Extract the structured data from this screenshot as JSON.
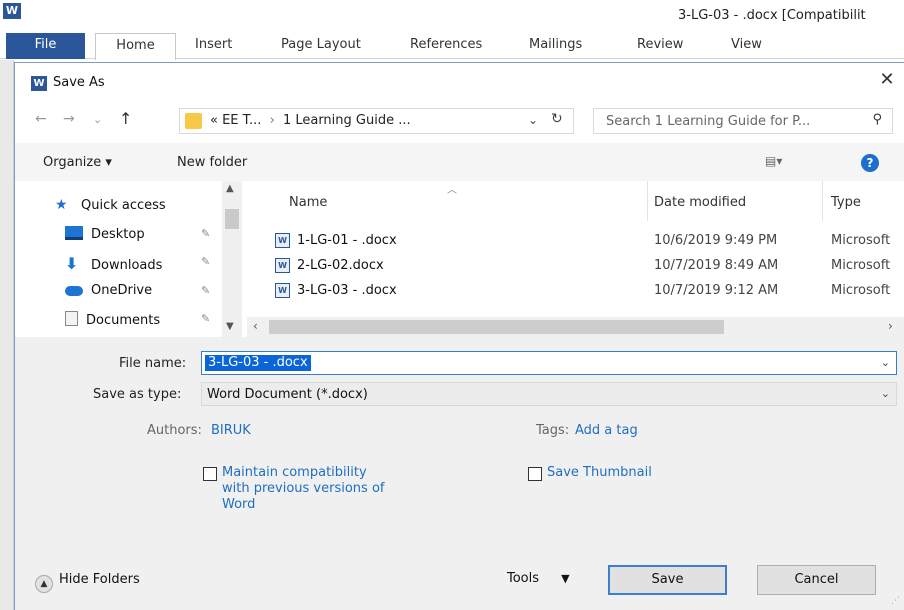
{
  "word": {
    "logo": "W",
    "title": "3-LG-03 - .docx [Compatibilit",
    "tabs": {
      "file": "File",
      "home": "Home",
      "insert": "Insert",
      "page_layout": "Page Layout",
      "references": "References",
      "mailings": "Mailings",
      "review": "Review",
      "view": "View"
    }
  },
  "dialog": {
    "icon": "W",
    "title": "Save As",
    "close": "✕",
    "address": {
      "crumb1": "«  EE T...",
      "sep": "›",
      "crumb2": "1 Learning Guide ...",
      "dropdown": "⌄",
      "refresh": "↻"
    },
    "search": {
      "placeholder": "Search 1 Learning Guide for P...",
      "icon": "magnifier-icon"
    },
    "toolbar": {
      "organize": "Organize ▾",
      "new_folder": "New folder",
      "view": "▤▾",
      "help": "?"
    },
    "nav_pane": {
      "items": [
        {
          "label": "Quick access",
          "icon": "star-icon"
        },
        {
          "label": "Desktop",
          "icon": "desktop-icon"
        },
        {
          "label": "Downloads",
          "icon": "download-icon"
        },
        {
          "label": "OneDrive",
          "icon": "cloud-icon"
        },
        {
          "label": "Documents",
          "icon": "document-icon"
        }
      ],
      "pin": "📌"
    },
    "columns": {
      "name": "Name",
      "date": "Date modified",
      "type": "Type"
    },
    "files": [
      {
        "name": "1-LG-01 - .docx",
        "date": "10/6/2019 9:49 PM",
        "type": "Microsoft"
      },
      {
        "name": "2-LG-02.docx",
        "date": "10/7/2019 8:49 AM",
        "type": "Microsoft"
      },
      {
        "name": "3-LG-03 - .docx",
        "date": "10/7/2019 9:12 AM",
        "type": "Microsoft"
      }
    ],
    "file_name_label": "File name:",
    "file_name_value": "3-LG-03 - .docx",
    "save_type_label": "Save as type:",
    "save_type_value": "Word Document (*.docx)",
    "authors_label": "Authors:",
    "authors_value": "BIRUK",
    "tags_label": "Tags:",
    "tags_value": "Add a tag",
    "maintain_compat": "Maintain compatibility with previous versions of Word",
    "save_thumbnail": "Save Thumbnail",
    "hide_folders": "Hide Folders",
    "tools": "Tools",
    "save": "Save",
    "cancel": "Cancel"
  }
}
